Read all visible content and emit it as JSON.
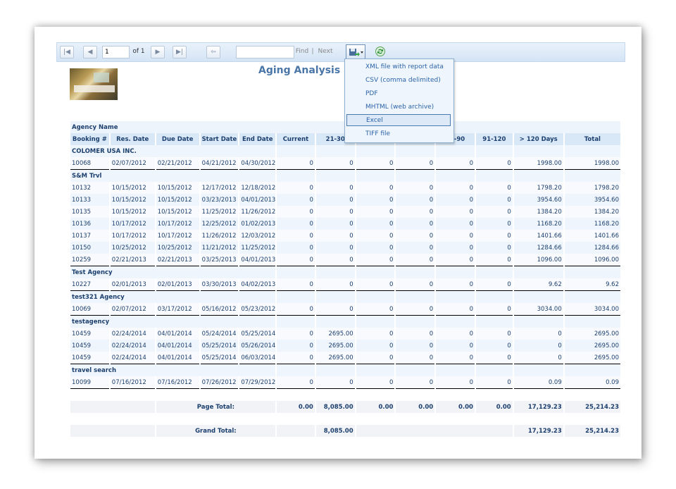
{
  "toolbar": {
    "page_value": "1",
    "of_label": "of 1",
    "find_label": "Find",
    "separator": "|",
    "next_label": "Next",
    "export_menu": [
      "XML file with report data",
      "CSV (comma delimited)",
      "PDF",
      "MHTML (web archive)",
      "Excel",
      "TIFF file"
    ],
    "export_selected": "Excel"
  },
  "report": {
    "title": "Aging Analysis De",
    "agency_header": "Agency Name",
    "columns": [
      "Booking #",
      "Res. Date",
      "Due Date",
      "Start Date",
      "End Date",
      "Current",
      "21-30",
      "31-45",
      "46-60",
      "61-90",
      "91-120",
      "> 120 Days",
      "Total"
    ],
    "groups": [
      {
        "agency": "COLOMER USA INC.",
        "rows": [
          [
            "10068",
            "02/07/2012",
            "02/21/2012",
            "04/21/2012",
            "04/30/2012",
            "0",
            "0",
            "0",
            "0",
            "0",
            "0",
            "1998.00",
            "1998.00"
          ]
        ]
      },
      {
        "agency": "S&M Trvl",
        "rows": [
          [
            "10132",
            "10/15/2012",
            "10/15/2012",
            "12/17/2012",
            "12/18/2012",
            "0",
            "0",
            "0",
            "0",
            "0",
            "0",
            "1798.20",
            "1798.20"
          ],
          [
            "10133",
            "10/15/2012",
            "10/15/2012",
            "03/23/2013",
            "04/01/2013",
            "0",
            "0",
            "0",
            "0",
            "0",
            "0",
            "3954.60",
            "3954.60"
          ],
          [
            "10135",
            "10/15/2012",
            "10/15/2012",
            "11/25/2012",
            "11/26/2012",
            "0",
            "0",
            "0",
            "0",
            "0",
            "0",
            "1384.20",
            "1384.20"
          ],
          [
            "10136",
            "10/17/2012",
            "10/17/2012",
            "12/25/2012",
            "01/02/2013",
            "0",
            "0",
            "0",
            "0",
            "0",
            "0",
            "1168.20",
            "1168.20"
          ],
          [
            "10137",
            "10/17/2012",
            "10/17/2012",
            "11/26/2012",
            "12/03/2012",
            "0",
            "0",
            "0",
            "0",
            "0",
            "0",
            "1401.66",
            "1401.66"
          ],
          [
            "10150",
            "10/25/2012",
            "10/25/2012",
            "11/21/2012",
            "11/25/2012",
            "0",
            "0",
            "0",
            "0",
            "0",
            "0",
            "1284.66",
            "1284.66"
          ],
          [
            "10259",
            "02/21/2013",
            "02/21/2013",
            "03/25/2013",
            "04/01/2013",
            "0",
            "0",
            "0",
            "0",
            "0",
            "0",
            "1096.00",
            "1096.00"
          ]
        ]
      },
      {
        "agency": "Test Agency",
        "rows": [
          [
            "10227",
            "02/01/2013",
            "02/01/2013",
            "03/30/2013",
            "04/02/2013",
            "0",
            "0",
            "0",
            "0",
            "0",
            "0",
            "9.62",
            "9.62"
          ]
        ]
      },
      {
        "agency": "test321 Agency",
        "rows": [
          [
            "10069",
            "02/07/2012",
            "03/17/2012",
            "05/16/2012",
            "05/23/2012",
            "0",
            "0",
            "0",
            "0",
            "0",
            "0",
            "3034.00",
            "3034.00"
          ]
        ]
      },
      {
        "agency": "testagency",
        "rows": [
          [
            "10459",
            "02/24/2014",
            "04/01/2014",
            "05/24/2014",
            "05/25/2014",
            "0",
            "2695.00",
            "0",
            "0",
            "0",
            "0",
            "0",
            "2695.00"
          ],
          [
            "10459",
            "02/24/2014",
            "04/01/2014",
            "05/25/2014",
            "05/26/2014",
            "0",
            "2695.00",
            "0",
            "0",
            "0",
            "0",
            "0",
            "2695.00"
          ],
          [
            "10459",
            "02/24/2014",
            "04/01/2014",
            "05/25/2014",
            "06/03/2014",
            "0",
            "2695.00",
            "0",
            "0",
            "0",
            "0",
            "0",
            "2695.00"
          ]
        ]
      },
      {
        "agency": "travel search",
        "rows": [
          [
            "10099",
            "07/16/2012",
            "07/16/2012",
            "07/26/2012",
            "07/29/2012",
            "0",
            "0",
            "0",
            "0",
            "0",
            "0",
            "0.09",
            "0.09"
          ]
        ]
      }
    ],
    "page_total": {
      "label": "Page Total:",
      "current": "0.00",
      "d21_30": "8,085.00",
      "d31_45": "0.00",
      "d46_60": "0.00",
      "d61_90": "0.00",
      "d91_120": "0.00",
      "over120": "17,129.23",
      "total": "25,214.23"
    },
    "grand_total": {
      "label": "Grand Total:",
      "d21_30": "8,085.00",
      "over120": "17,129.23",
      "total": "25,214.23"
    }
  }
}
